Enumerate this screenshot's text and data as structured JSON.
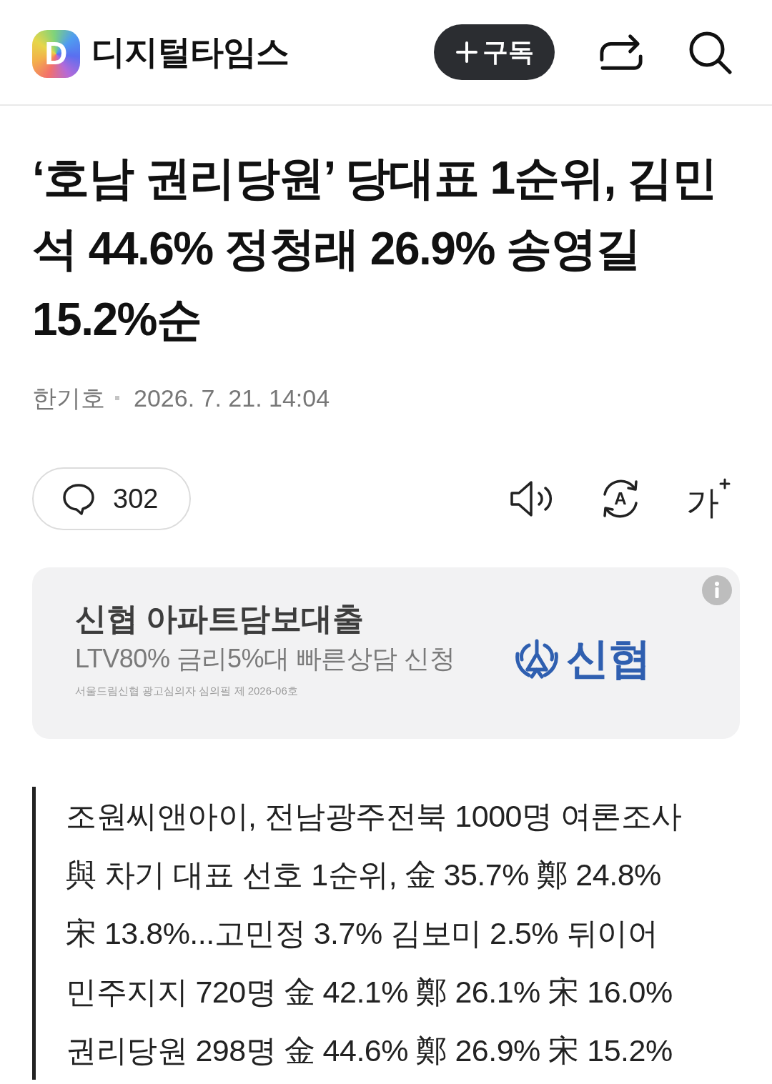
{
  "header": {
    "logo_mark": "D",
    "site_name": "디지털타임스",
    "subscribe_button": "구독",
    "actions": [
      {
        "kind": "share"
      },
      {
        "kind": "search"
      }
    ]
  },
  "article": {
    "headline": "‘호남 권리당원’ 당대표 1순위, 김민석 44.6% 정청래 26.9% 송영길 15.2%순",
    "author": "한기호",
    "published": "2026. 7. 21. 14:04"
  },
  "toolbar": {
    "comment_count": "302",
    "tools": [
      {
        "kind": "listen"
      },
      {
        "kind": "translate",
        "label": "A"
      },
      {
        "kind": "font_size",
        "label": "가"
      }
    ]
  },
  "ad": {
    "title": "신협 아파트담보대출",
    "subtitle": "LTV80% 금리5%대 빠른상담 신청",
    "disclaimer": "서울드림신협 광고심의자 심의필 제 2026-06호",
    "brand": "신협"
  },
  "summary": {
    "lines": [
      "조원씨앤아이, 전남광주전북 1000명 여론조사",
      "與 차기 대표 선호 1순위, 金 35.7% 鄭 24.8%",
      "宋 13.8%...고민정 3.7% 김보미 2.5% 뒤이어",
      "민주지지 720명 金 42.1% 鄭 26.1% 宋 16.0%",
      "권리당원 298명 金 44.6% 鄭 26.9% 宋 15.2%"
    ]
  }
}
